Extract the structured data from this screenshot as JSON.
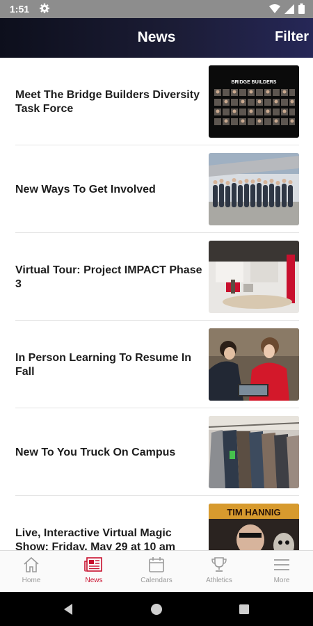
{
  "status_bar": {
    "time": "1:51"
  },
  "header": {
    "title": "News",
    "filter_label": "Filter"
  },
  "news": [
    {
      "title": "Meet The Bridge Builders Diversity Task Force",
      "thumb_caption": "BRIDGE BUILDERS"
    },
    {
      "title": "New Ways To Get Involved"
    },
    {
      "title": "Virtual Tour: Project IMPACT Phase 3"
    },
    {
      "title": "In Person Learning To Resume In Fall"
    },
    {
      "title": "New To You Truck On Campus"
    },
    {
      "title": "Live, Interactive Virtual Magic Show: Friday, May 29 at 10 am",
      "thumb_caption": "TIM HANNIG"
    }
  ],
  "bottom_nav": {
    "items": [
      {
        "label": "Home",
        "icon": "home-icon"
      },
      {
        "label": "News",
        "icon": "newspaper-icon"
      },
      {
        "label": "Calendars",
        "icon": "calendar-icon"
      },
      {
        "label": "Athletics",
        "icon": "trophy-icon"
      },
      {
        "label": "More",
        "icon": "menu-icon"
      }
    ],
    "active": "News"
  },
  "colors": {
    "accent": "#c8102e",
    "header_dark": "#0d0f1c",
    "header_light": "#262757",
    "status_bar": "#8d8d8d"
  }
}
